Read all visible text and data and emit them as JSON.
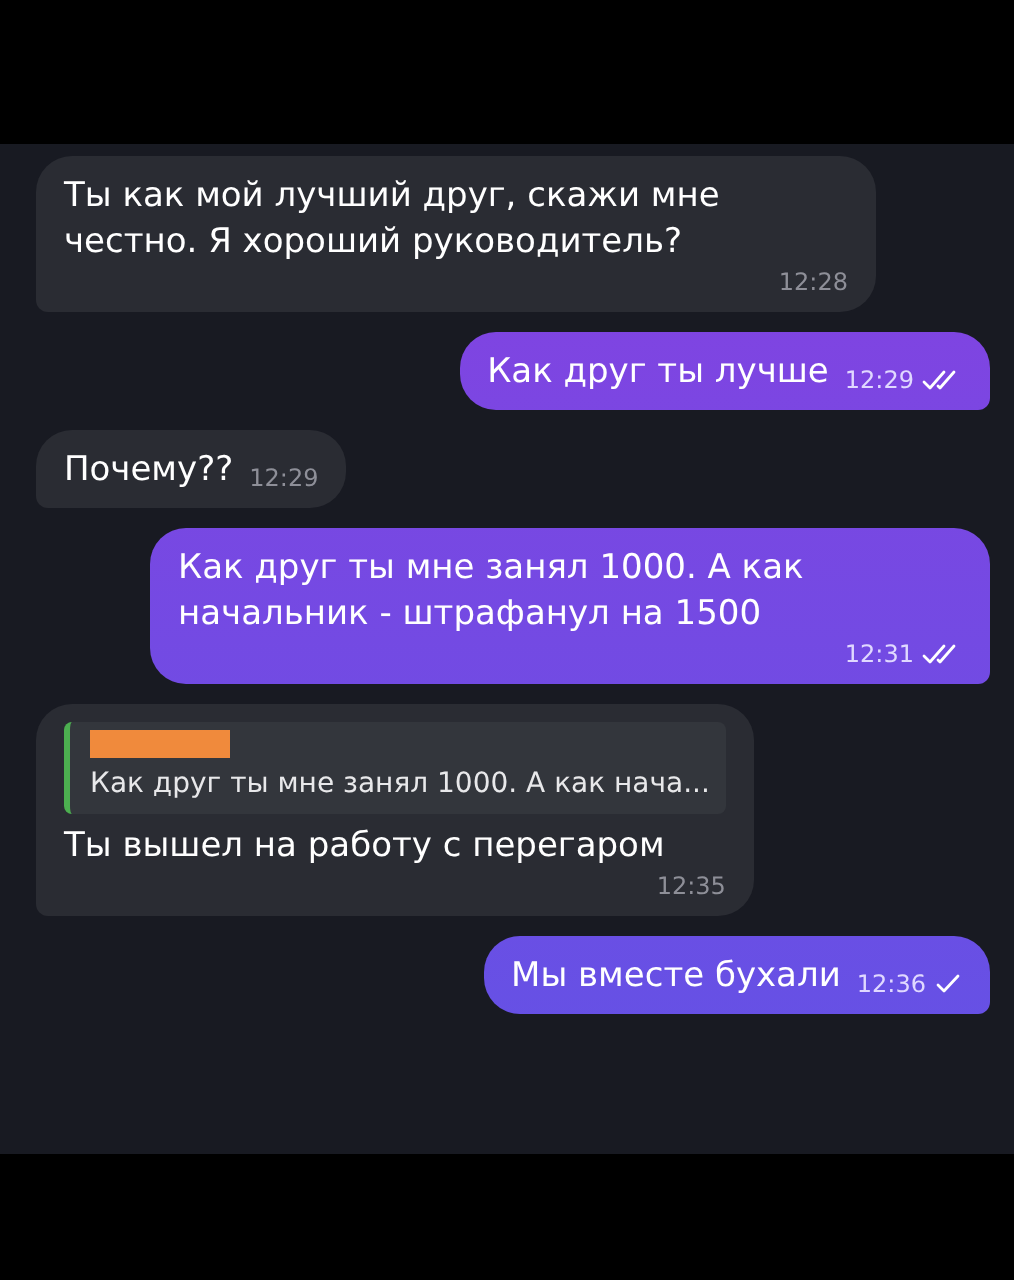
{
  "messages": [
    {
      "outgoing": false,
      "text": "Ты как мой лучший друг, скажи мне честно. Я хороший руководитель?",
      "time": "12:28",
      "time_inline": false
    },
    {
      "outgoing": true,
      "text": "Как друг ты лучше",
      "time": "12:29",
      "time_inline": true,
      "read": true
    },
    {
      "outgoing": false,
      "text": "Почему??",
      "time": "12:29",
      "time_inline": true
    },
    {
      "outgoing": true,
      "text": "Как друг ты мне занял 1000. А как начальник - штрафанул на 1500",
      "time": "12:31",
      "time_inline": false,
      "read": true
    },
    {
      "outgoing": false,
      "text": "Ты вышел на работу с перегаром",
      "time": "12:35",
      "time_inline": false,
      "reply": {
        "author_redacted": true,
        "text": "Как друг ты мне занял 1000. А как нача..."
      }
    },
    {
      "outgoing": true,
      "text": "Мы вместе бухали",
      "time": "12:36",
      "time_inline": true,
      "read": false
    }
  ]
}
